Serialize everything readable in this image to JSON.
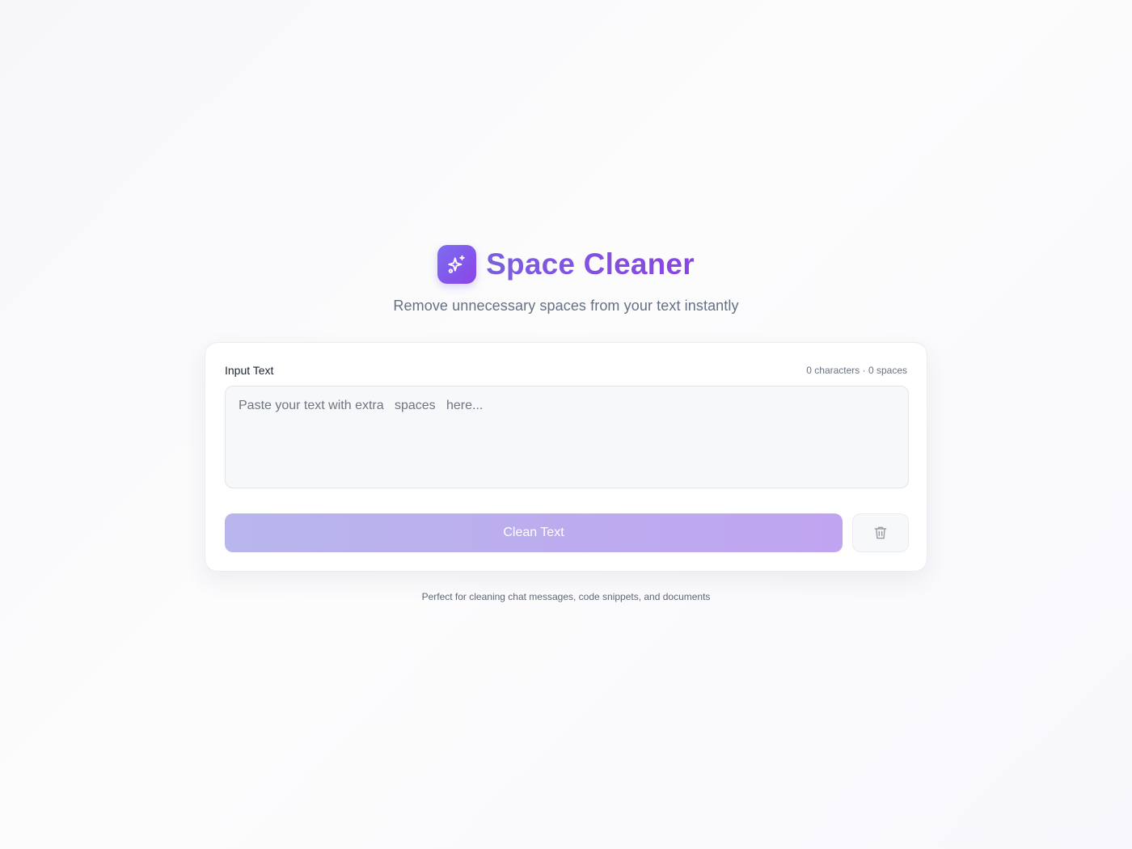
{
  "app": {
    "title": "Space Cleaner",
    "subtitle": "Remove unnecessary spaces from your text instantly",
    "logo_icon": "sparkles-icon"
  },
  "input": {
    "label": "Input Text",
    "stats": "0 characters · 0 spaces",
    "value": "",
    "placeholder": "Paste your text with extra   spaces   here..."
  },
  "actions": {
    "clean_label": "Clean Text",
    "clear_icon": "trash-icon"
  },
  "footer": {
    "note": "Perfect for cleaning chat messages, code snippets, and documents"
  },
  "colors": {
    "brand_start": "#7c6cf0",
    "brand_end": "#8a45e6",
    "button_start": "#b8b6ec",
    "button_end": "#c0a4f1"
  }
}
